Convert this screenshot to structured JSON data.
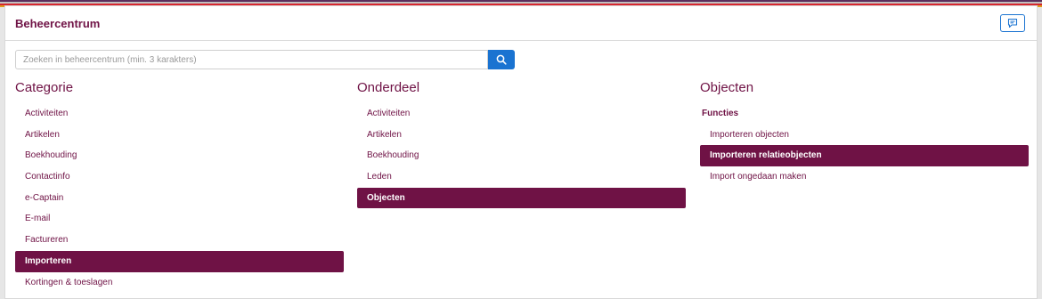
{
  "header": {
    "title": "Beheercentrum",
    "stripe_colors": [
      "#5a2d5c",
      "#c0c0c0",
      "#d7262e",
      "#e09a1c"
    ],
    "feedback_icon": "chat-icon"
  },
  "search": {
    "placeholder": "Zoeken in beheercentrum (min. 3 karakters)",
    "value": "",
    "button_icon": "search-icon"
  },
  "columns": {
    "categorie": {
      "heading": "Categorie",
      "items": [
        "Activiteiten",
        "Artikelen",
        "Boekhouding",
        "Contactinfo",
        "e-Captain",
        "E-mail",
        "Factureren",
        "Importeren",
        "Kortingen & toeslagen"
      ],
      "active": "Importeren"
    },
    "onderdeel": {
      "heading": "Onderdeel",
      "items": [
        "Activiteiten",
        "Artikelen",
        "Boekhouding",
        "Leden",
        "Objecten"
      ],
      "active": "Objecten"
    },
    "objecten": {
      "heading": "Objecten",
      "group": "Functies",
      "items": [
        "Importeren objecten",
        "Importeren relatieobjecten",
        "Import ongedaan maken"
      ],
      "active": "Importeren relatieobjecten"
    }
  },
  "colors": {
    "brand": "#6f1245",
    "accent": "#1a73d1"
  }
}
